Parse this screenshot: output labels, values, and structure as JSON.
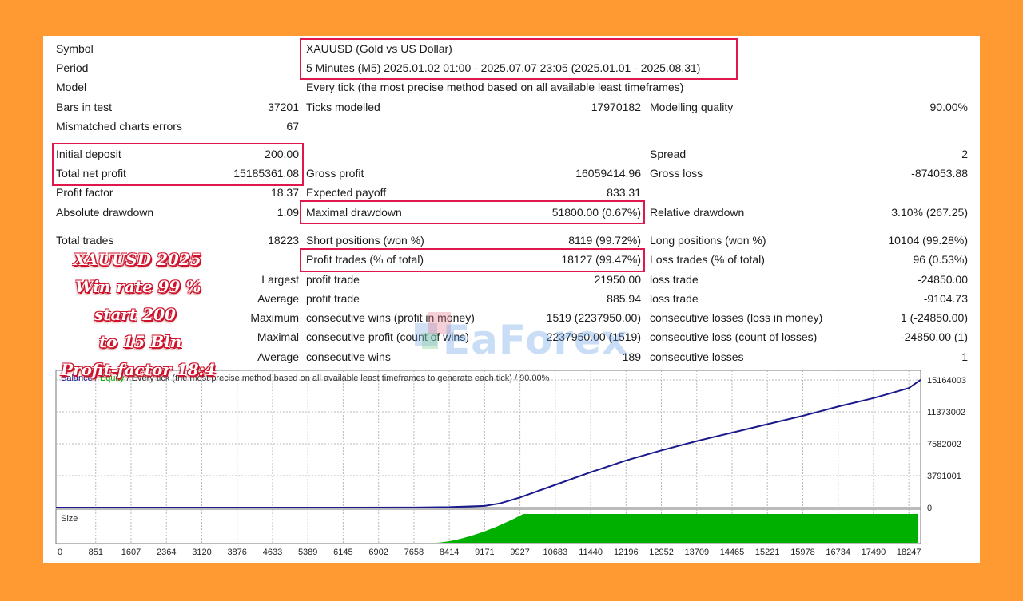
{
  "report": {
    "symbol_label": "Symbol",
    "symbol_value": "XAUUSD (Gold vs US Dollar)",
    "period_label": "Period",
    "period_value": "5 Minutes (M5) 2025.01.02 01:00 - 2025.07.07 23:05 (2025.01.01 - 2025.08.31)",
    "model_label": "Model",
    "model_value": "Every tick (the most precise method based on all available least timeframes)",
    "bars_label": "Bars in test",
    "bars_value": "37201",
    "ticks_label": "Ticks modelled",
    "ticks_value": "17970182",
    "quality_label": "Modelling quality",
    "quality_value": "90.00%",
    "mismatch_label": "Mismatched charts errors",
    "mismatch_value": "67",
    "deposit_label": "Initial deposit",
    "deposit_value": "200.00",
    "spread_label": "Spread",
    "spread_value": "2",
    "net_label": "Total net profit",
    "net_value": "15185361.08",
    "gross_profit_label": "Gross profit",
    "gross_profit_value": "16059414.96",
    "gross_loss_label": "Gross loss",
    "gross_loss_value": "-874053.88",
    "pf_label": "Profit factor",
    "pf_value": "18.37",
    "payoff_label": "Expected payoff",
    "payoff_value": "833.31",
    "absdd_label": "Absolute drawdown",
    "absdd_value": "1.09",
    "maxdd_label": "Maximal drawdown",
    "maxdd_value": "51800.00 (0.67%)",
    "reldd_label": "Relative drawdown",
    "reldd_value": "3.10% (267.25)",
    "trades_label": "Total trades",
    "trades_value": "18223",
    "short_label": "Short positions (won %)",
    "short_value": "8119 (99.72%)",
    "long_label": "Long positions (won %)",
    "long_value": "10104 (99.28%)",
    "ptrades_label": "Profit trades (% of total)",
    "ptrades_value": "18127 (99.47%)",
    "ltrades_label": "Loss trades (% of total)",
    "ltrades_value": "96 (0.53%)",
    "largest_label": "Largest",
    "largest_pt_label": "profit trade",
    "largest_pt_value": "21950.00",
    "largest_lt_label": "loss trade",
    "largest_lt_value": "-24850.00",
    "average_label": "Average",
    "average_pt_label": "profit trade",
    "average_pt_value": "885.94",
    "average_lt_label": "loss trade",
    "average_lt_value": "-9104.73",
    "maximum_label": "Maximum",
    "max_cw_label": "consecutive wins (profit in money)",
    "max_cw_value": "1519 (2237950.00)",
    "max_cl_label": "consecutive losses (loss in money)",
    "max_cl_value": "1 (-24850.00)",
    "maximal_label": "Maximal",
    "mxl_cp_label": "consecutive profit (count of wins)",
    "mxl_cp_value": "2237950.00 (1519)",
    "mxl_cl_label": "consecutive loss (count of losses)",
    "mxl_cl_value": "-24850.00 (1)",
    "average2_label": "Average",
    "avg_cw_label": "consecutive wins",
    "avg_cw_value": "189",
    "avg_cl_label": "consecutive losses",
    "avg_cl_value": "1"
  },
  "promo": {
    "line1": "XAUUSD 2025",
    "line2": "Win rate 99 %",
    "line3": "start 200",
    "line4": "to 15 Bln",
    "line5": "Profit-factor 18:4"
  },
  "watermark": {
    "text": "EaForex"
  },
  "colors": {
    "background": "#ff9a33",
    "highlight": "#e0174a",
    "balance": "#1a1a8c",
    "equity": "#00b000",
    "size_bars": "#00b000"
  },
  "chart_data": {
    "type": "line",
    "legend_text": {
      "balance": "Balance",
      "separator": " / ",
      "equity": "Equity",
      "rest": " / Every tick (the most precise method based on all available least timeframes to generate each tick) / 90.00%"
    },
    "y_ticks": [
      "15164003",
      "11373002",
      "7582002",
      "3791001",
      "0"
    ],
    "ylim": [
      0,
      15164003
    ],
    "x_ticks": [
      "0",
      "851",
      "1607",
      "2364",
      "3120",
      "3876",
      "4633",
      "5389",
      "6145",
      "6902",
      "7658",
      "8414",
      "9171",
      "9927",
      "10683",
      "11440",
      "12196",
      "12952",
      "13709",
      "14465",
      "15221",
      "15978",
      "16734",
      "17490",
      "18247"
    ],
    "xlim": [
      0,
      18500
    ],
    "series": [
      {
        "name": "Balance",
        "x": [
          0,
          2000,
          4000,
          6000,
          7658,
          8414,
          9171,
          9500,
          9927,
          10683,
          11440,
          12196,
          12952,
          13709,
          14465,
          15221,
          15978,
          16734,
          17490,
          18247,
          18500
        ],
        "y": [
          200,
          1000,
          2000,
          4000,
          8000,
          60000,
          200000,
          500000,
          1200000,
          2700000,
          4200000,
          5600000,
          6800000,
          7900000,
          8900000,
          9900000,
          10900000,
          12000000,
          13000000,
          14200000,
          15185361
        ]
      }
    ],
    "size_panel": {
      "label": "Size",
      "start_x": 8100,
      "ramp_end_x": 10000,
      "end_x": 18500,
      "max_level": 1.0
    }
  }
}
